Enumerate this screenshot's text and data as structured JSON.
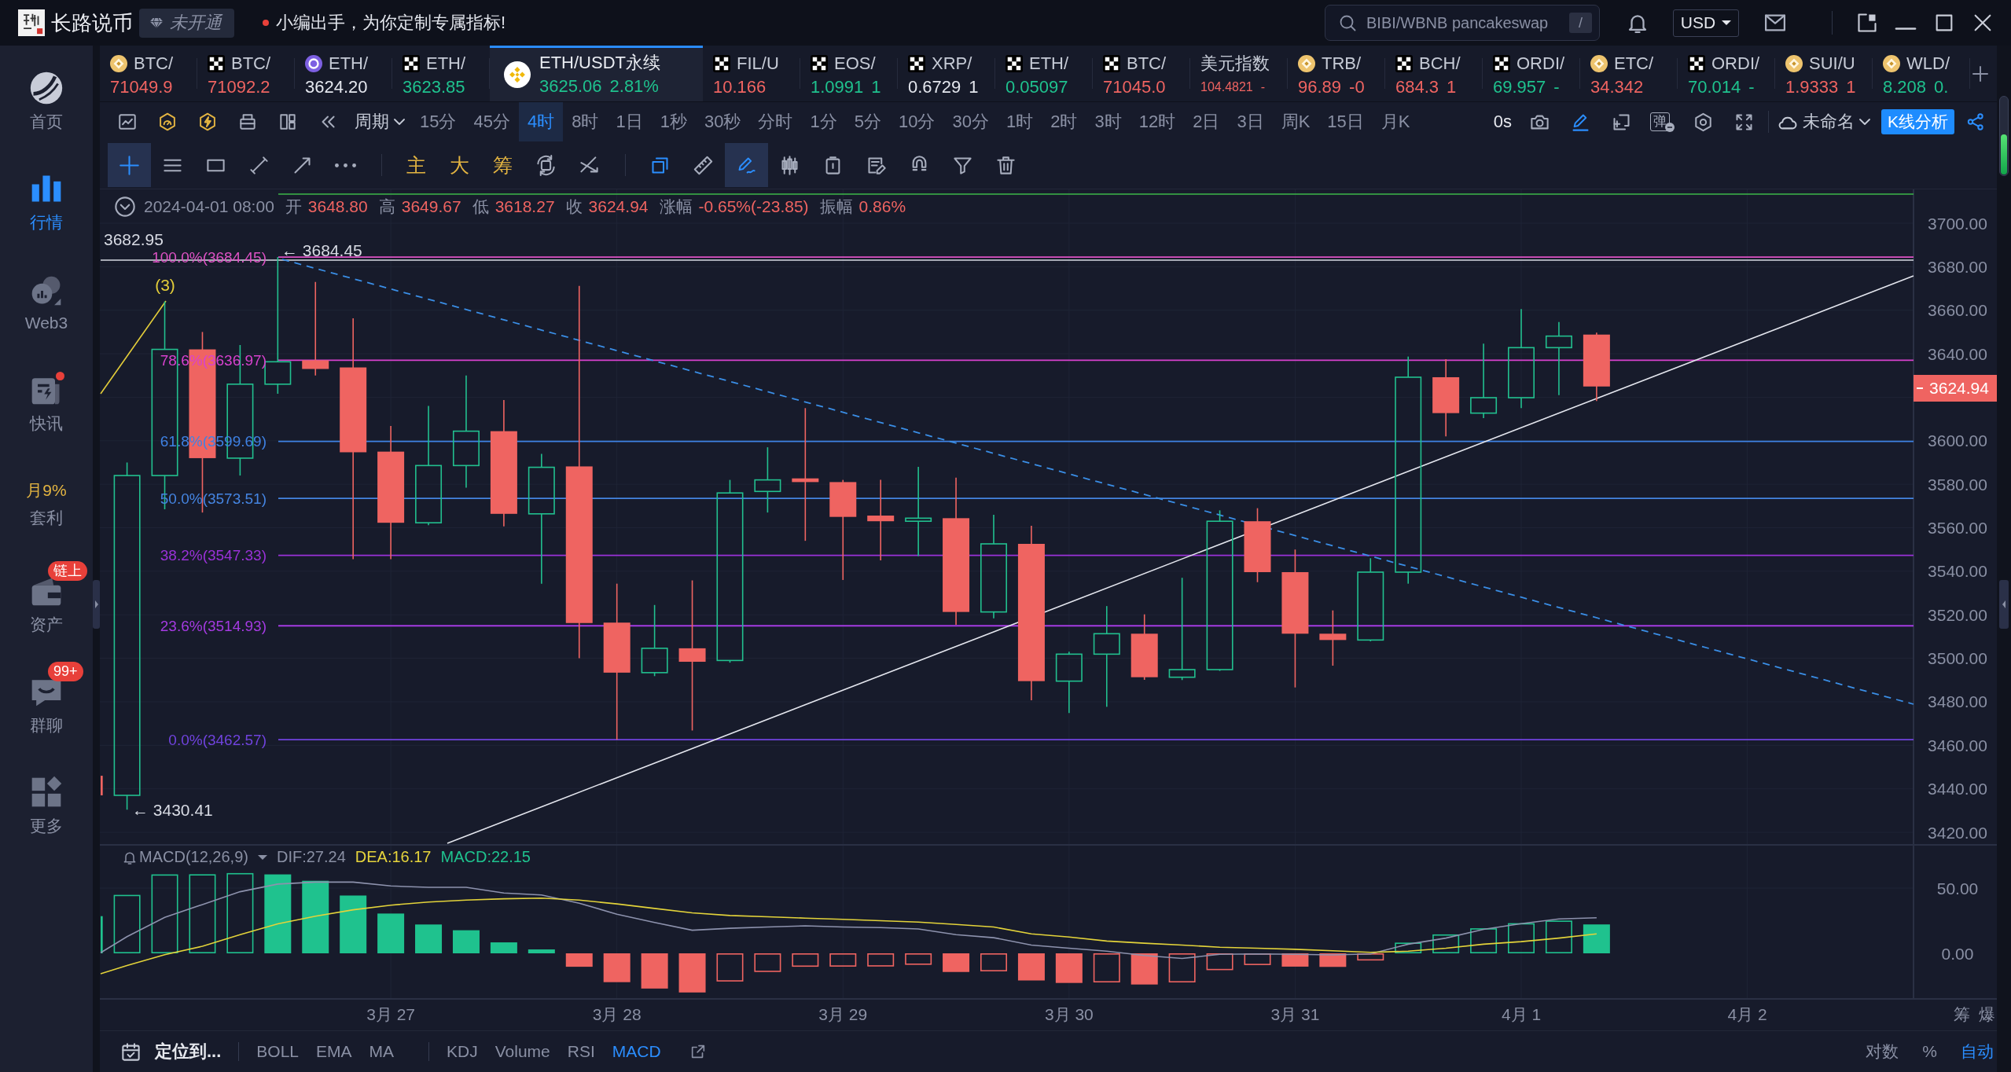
{
  "title_bar": {
    "app_name": "长路说币",
    "membership": "未开通",
    "notice": "小编出手，为你定制专属指标!",
    "search": {
      "placeholder": "BIBI/WBNB pancakeswap",
      "shortcut": "/"
    },
    "currency": "USD"
  },
  "sidebar": {
    "items": [
      {
        "kind": "home",
        "label": "首页",
        "selected": false,
        "dot": false
      },
      {
        "kind": "market",
        "label": "行情",
        "selected": true,
        "dot": false
      },
      {
        "kind": "web3",
        "label": "Web3",
        "selected": false,
        "dot": false
      },
      {
        "kind": "news",
        "label": "快讯",
        "selected": false,
        "dot": true
      },
      {
        "kind": "promo",
        "label": "套利",
        "promo": "月9%",
        "selected": false,
        "dot": false
      },
      {
        "kind": "wallet",
        "label": "资产",
        "badge": "链上",
        "selected": false,
        "dot": false
      },
      {
        "kind": "chat",
        "label": "群聊",
        "badge": "99+",
        "selected": false,
        "dot": false
      },
      {
        "kind": "more",
        "label": "更多",
        "selected": false,
        "dot": false
      }
    ]
  },
  "tickers": [
    {
      "kind": "gold",
      "symbol": "BTC/",
      "price": "71049.9",
      "color": "#ef6461",
      "selected": false
    },
    {
      "kind": "checker",
      "symbol": "BTC/",
      "price": "71092.2",
      "color": "#ef6461",
      "selected": false
    },
    {
      "kind": "violet",
      "symbol": "ETH/",
      "price": "3624.20",
      "color": "#e4e7ee",
      "selected": false
    },
    {
      "kind": "checker",
      "symbol": "ETH/",
      "price": "3623.85",
      "color": "#1fc28e",
      "selected": false
    },
    {
      "kind": "binance",
      "symbol": "ETH/USDT永续",
      "price": "3625.06",
      "change": "2.81%",
      "color": "#1fc28e",
      "selected": true
    },
    {
      "kind": "checker",
      "symbol": "FIL/U",
      "price": "10.166",
      "color": "#ef6461",
      "selected": false
    },
    {
      "kind": "checker",
      "symbol": "EOS/",
      "price": "1.0991",
      "change": "1",
      "color": "#1fc28e",
      "selected": false
    },
    {
      "kind": "checker",
      "symbol": "XRP/",
      "price": "0.6729",
      "change": "1",
      "color": "#e4e7ee",
      "selected": false
    },
    {
      "kind": "checker",
      "symbol": "ETH/",
      "price": "0.05097",
      "color": "#1fc28e",
      "selected": false
    },
    {
      "kind": "checker",
      "symbol": "BTC/",
      "price": "71045.0",
      "color": "#ef6461",
      "selected": false
    },
    {
      "kind": "plain",
      "symbol": "美元指数",
      "price": "104.4821",
      "change": "-",
      "color": "#ef6461",
      "selected": false
    },
    {
      "kind": "gold",
      "symbol": "TRB/",
      "price": "96.89",
      "change": "-0",
      "color": "#ef6461",
      "selected": false
    },
    {
      "kind": "checker",
      "symbol": "BCH/",
      "price": "684.3",
      "change": "1",
      "color": "#ef6461",
      "selected": false
    },
    {
      "kind": "checker",
      "symbol": "ORDI/",
      "price": "69.957",
      "change": "-",
      "color": "#1fc28e",
      "selected": false
    },
    {
      "kind": "gold",
      "symbol": "ETC/",
      "price": "34.342",
      "color": "#ef6461",
      "selected": false
    },
    {
      "kind": "checker",
      "symbol": "ORDI/",
      "price": "70.014",
      "change": "-",
      "color": "#1fc28e",
      "selected": false
    },
    {
      "kind": "gold",
      "symbol": "SUI/U",
      "price": "1.9333",
      "change": "1",
      "color": "#ef6461",
      "selected": false
    },
    {
      "kind": "gold",
      "symbol": "WLD/",
      "price": "8.208",
      "change": "0.",
      "color": "#1fc28e",
      "selected": false
    }
  ],
  "period_bar": {
    "tools": [
      {
        "kind": "chart"
      },
      {
        "kind": "gauge"
      },
      {
        "kind": "bolt"
      },
      {
        "kind": "print"
      },
      {
        "kind": "layout"
      },
      {
        "kind": "rewind"
      }
    ],
    "period_menu": "周期",
    "periods": [
      {
        "label": "15分",
        "selected": false
      },
      {
        "label": "45分",
        "selected": false
      },
      {
        "label": "4时",
        "selected": true
      },
      {
        "label": "8时",
        "selected": false
      },
      {
        "label": "1日",
        "selected": false
      },
      {
        "label": "1秒",
        "selected": false
      },
      {
        "label": "30秒",
        "selected": false
      },
      {
        "label": "分时",
        "selected": false
      },
      {
        "label": "1分",
        "selected": false
      },
      {
        "label": "5分",
        "selected": false
      },
      {
        "label": "10分",
        "selected": false
      },
      {
        "label": "30分",
        "selected": false
      },
      {
        "label": "1时",
        "selected": false
      },
      {
        "label": "2时",
        "selected": false
      },
      {
        "label": "3时",
        "selected": false
      },
      {
        "label": "12时",
        "selected": false
      },
      {
        "label": "2日",
        "selected": false
      },
      {
        "label": "3日",
        "selected": false
      },
      {
        "label": "周K",
        "selected": false
      },
      {
        "label": "15日",
        "selected": false
      },
      {
        "label": "月K",
        "selected": false
      }
    ],
    "countdown": "0s",
    "actions": [
      {
        "kind": "camera",
        "active": false
      },
      {
        "kind": "pencil",
        "active": true
      },
      {
        "kind": "frame",
        "active": false
      },
      {
        "kind": "popup",
        "label": "弹",
        "active": false
      },
      {
        "kind": "hexagon",
        "active": false
      },
      {
        "kind": "fullscreen",
        "active": false
      }
    ],
    "layout_name": "未命名",
    "analysis_button": "K线分析"
  },
  "draw_toolbar": {
    "groups": [
      [
        {
          "kind": "crosshair",
          "selected": true,
          "active": false
        },
        {
          "kind": "hlines",
          "selected": false,
          "active": false
        },
        {
          "kind": "rect",
          "selected": false,
          "active": false
        },
        {
          "kind": "segment",
          "selected": false,
          "active": false
        },
        {
          "kind": "ray",
          "selected": false,
          "active": false
        },
        {
          "kind": "dots",
          "selected": false,
          "active": false
        }
      ],
      [
        {
          "kind": "text",
          "label": "主",
          "selected": false,
          "active": false
        },
        {
          "kind": "text",
          "label": "大",
          "selected": false,
          "active": false
        },
        {
          "kind": "text",
          "label": "筹",
          "selected": false,
          "active": false
        },
        {
          "kind": "rotate",
          "selected": false,
          "active": false
        },
        {
          "kind": "cross",
          "selected": false,
          "active": false
        }
      ],
      [
        {
          "kind": "layers",
          "selected": false,
          "active": true
        },
        {
          "kind": "ruler",
          "selected": false,
          "active": false
        },
        {
          "kind": "pen",
          "selected": true,
          "active": false
        },
        {
          "kind": "candles",
          "selected": false,
          "active": false
        },
        {
          "kind": "clip",
          "selected": false,
          "active": false
        },
        {
          "kind": "edit",
          "selected": false,
          "active": false
        },
        {
          "kind": "magnet",
          "selected": false,
          "active": false
        },
        {
          "kind": "filter",
          "selected": false,
          "active": false
        },
        {
          "kind": "trash",
          "selected": false,
          "active": false
        }
      ]
    ]
  },
  "chart": {
    "ohlc": {
      "datetime": "2024-04-01 08:00",
      "color": "#ef6461",
      "fields": [
        {
          "label": "开",
          "value": "3648.80"
        },
        {
          "label": "高",
          "value": "3649.67"
        },
        {
          "label": "低",
          "value": "3618.27"
        },
        {
          "label": "收",
          "value": "3624.94"
        },
        {
          "label": "涨幅",
          "value": "-0.65%(-23.85)"
        },
        {
          "label": "振幅",
          "value": "0.86%"
        }
      ]
    },
    "price_line_label": "3682.95",
    "high_marker": "← 3684.45",
    "low_marker": "← 3430.41",
    "wave_label": "(3)",
    "fib_levels": [
      {
        "label": "100.0%(3684.45)",
        "color": "#dd52c4"
      },
      {
        "label": "78.6%(3636.97)",
        "color": "#d842cf"
      },
      {
        "label": "61.8%(3599.69)",
        "color": "#3f82e4"
      },
      {
        "label": "50.0%(3573.51)",
        "color": "#4585e2"
      },
      {
        "label": "38.2%(3547.33)",
        "color": "#9a32d8"
      },
      {
        "label": "23.6%(3514.93)",
        "color": "#a53be2"
      },
      {
        "label": "0.0%(3462.57)",
        "color": "#7043de"
      }
    ],
    "last_price": "3624.94",
    "price_axis": [
      "3700.00",
      "3680.00",
      "3660.00",
      "3640.00",
      "3600.00",
      "3580.00",
      "3560.00",
      "3540.00",
      "3520.00",
      "3500.00",
      "3480.00",
      "3460.00",
      "3440.00",
      "3420.00"
    ],
    "macd": {
      "title": "MACD(12,26,9)",
      "dif": "DIF:27.24",
      "dea": "DEA:16.17",
      "value": "MACD:22.15",
      "axis": [
        "50.00",
        "0.00"
      ]
    },
    "date_axis": [
      "3月 27",
      "3月 28",
      "3月 29",
      "3月 30",
      "3月 31",
      "4月 1",
      "4月 2"
    ],
    "corner_buttons": [
      "筹",
      "爆"
    ]
  },
  "bottom_bar": {
    "locate": "定位到...",
    "main_indicators": [
      {
        "label": "BOLL",
        "selected": false
      },
      {
        "label": "EMA",
        "selected": false
      },
      {
        "label": "MA",
        "selected": false
      }
    ],
    "sub_indicators": [
      {
        "label": "KDJ",
        "selected": false
      },
      {
        "label": "Volume",
        "selected": false
      },
      {
        "label": "RSI",
        "selected": false
      },
      {
        "label": "MACD",
        "selected": true
      }
    ],
    "scales": [
      {
        "label": "对数",
        "selected": false
      },
      {
        "label": "%",
        "selected": false
      },
      {
        "label": "自动",
        "selected": true
      }
    ]
  }
}
